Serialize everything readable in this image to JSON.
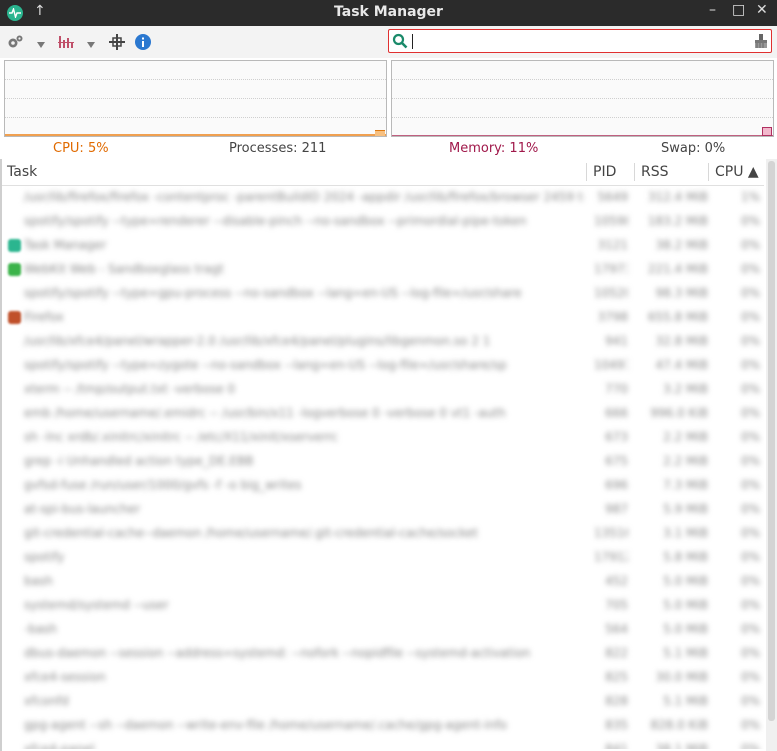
{
  "window": {
    "title": "Task Manager"
  },
  "icons": {
    "app": "activity-icon",
    "up": "up-arrow-icon",
    "minimize": "minimize-icon",
    "maximize": "maximize-icon",
    "close": "close-icon",
    "settings": "gear-icon",
    "dropdown": "chevron-down-icon",
    "graph": "bar-graph-icon",
    "crosshair": "crosshair-icon",
    "info": "info-icon",
    "search": "search-icon",
    "clear": "clear-icon"
  },
  "titlebar_glyphs": {
    "up": "↑",
    "minimize": "–",
    "maximize": "□",
    "close": "✕"
  },
  "search": {
    "value": ""
  },
  "summary": {
    "cpu": "CPU: 5%",
    "processes": "Processes: 211",
    "memory": "Memory: 11%",
    "swap": "Swap: 0%"
  },
  "colors": {
    "cpu": "#e06a00",
    "memory": "#a0184a",
    "search_border": "#e03030",
    "info": "#2b78d0"
  },
  "table": {
    "columns": {
      "task": "Task",
      "pid": "PID",
      "rss": "RSS",
      "cpu": "CPU ▲"
    },
    "rows": [
      {
        "task": "/usr/lib/firefox/firefox -contentproc -parentBuildID 2024 -appdir /usr/lib/firefox/browser 2459 true tab",
        "pid": "5649",
        "rss": "312.4 MiB",
        "cpu": "1%",
        "icon": ""
      },
      {
        "task": "spotify/spotify --type=renderer --disable-pinch --no-sandbox --primordial-pipe-token",
        "pid": "10598",
        "rss": "183.2 MiB",
        "cpu": "0%",
        "icon": ""
      },
      {
        "task": "Task Manager",
        "pid": "3121",
        "rss": "38.2 MiB",
        "cpu": "0%",
        "icon": "#2bb58f"
      },
      {
        "task": "WebKit Web - Sandboxglass tragt",
        "pid": "17973",
        "rss": "221.4 MiB",
        "cpu": "0%",
        "icon": "#3bb34a"
      },
      {
        "task": "spotify/spotify --type=gpu-process --no-sandbox --lang=en-US --log-file=/usr/share",
        "pid": "10520",
        "rss": "98.3 MiB",
        "cpu": "0%",
        "icon": ""
      },
      {
        "task": "Firefox",
        "pid": "3798",
        "rss": "655.8 MiB",
        "cpu": "0%",
        "icon": "#c0502a"
      },
      {
        "task": "/usr/lib/xfce4/panel/wrapper-2.0 /usr/lib/xfce4/panel/plugins/libgenmon.so 2 1",
        "pid": "941",
        "rss": "32.8 MiB",
        "cpu": "0%",
        "icon": ""
      },
      {
        "task": "spotify/spotify --type=zygote --no-sandbox --lang=en-US --log-file=/usr/share/sp",
        "pid": "10497",
        "rss": "47.4 MiB",
        "cpu": "0%",
        "icon": ""
      },
      {
        "task": "xterm -- /tmp/output.txt -verbose 0",
        "pid": "770",
        "rss": "3.2 MiB",
        "cpu": "0%",
        "icon": ""
      },
      {
        "task": "emb /home/username/.emidrc -- /usr/bin/x11 -logverbose 0 -verbose 0 vt1 -auth",
        "pid": "666",
        "rss": "996.0 KiB",
        "cpu": "0%",
        "icon": ""
      },
      {
        "task": "sh -lnc xrdb/.xinitrc/xinitrc -- /etc/X11/xinit/xserverrc",
        "pid": "673",
        "rss": "2.2 MiB",
        "cpu": "0%",
        "icon": ""
      },
      {
        "task": "grep -i Unhandled action type_DE.EBB",
        "pid": "675",
        "rss": "2.2 MiB",
        "cpu": "0%",
        "icon": ""
      },
      {
        "task": "gvfsd-fuse /run/user/1000/gvfs -f -o big_writes",
        "pid": "696",
        "rss": "7.3 MiB",
        "cpu": "0%",
        "icon": ""
      },
      {
        "task": "at-spi-bus-launcher",
        "pid": "987",
        "rss": "5.9 MiB",
        "cpu": "0%",
        "icon": ""
      },
      {
        "task": "git-credential-cache--daemon /home/username/.git-credential-cache/socket",
        "pid": "13516",
        "rss": "3.1 MiB",
        "cpu": "0%",
        "icon": ""
      },
      {
        "task": "spotify",
        "pid": "17912",
        "rss": "5.8 MiB",
        "cpu": "0%",
        "icon": ""
      },
      {
        "task": "bash",
        "pid": "452",
        "rss": "5.0 MiB",
        "cpu": "0%",
        "icon": ""
      },
      {
        "task": "systemd/systemd --user",
        "pid": "705",
        "rss": "5.0 MiB",
        "cpu": "0%",
        "icon": ""
      },
      {
        "task": "-bash",
        "pid": "564",
        "rss": "5.0 MiB",
        "cpu": "0%",
        "icon": ""
      },
      {
        "task": "dbus-daemon --session --address=systemd: --nofork --nopidfile --systemd-activation",
        "pid": "822",
        "rss": "5.1 MiB",
        "cpu": "0%",
        "icon": ""
      },
      {
        "task": "xfce4-session",
        "pid": "825",
        "rss": "30.0 MiB",
        "cpu": "0%",
        "icon": ""
      },
      {
        "task": "xfconfd",
        "pid": "828",
        "rss": "5.1 MiB",
        "cpu": "0%",
        "icon": ""
      },
      {
        "task": "gpg-agent --sh --daemon --write-env-file /home/username/.cache/gpg-agent-info",
        "pid": "835",
        "rss": "828.0 KiB",
        "cpu": "0%",
        "icon": ""
      },
      {
        "task": "xfce4-panel",
        "pid": "841",
        "rss": "38.1 MiB",
        "cpu": "0%",
        "icon": ""
      }
    ]
  }
}
